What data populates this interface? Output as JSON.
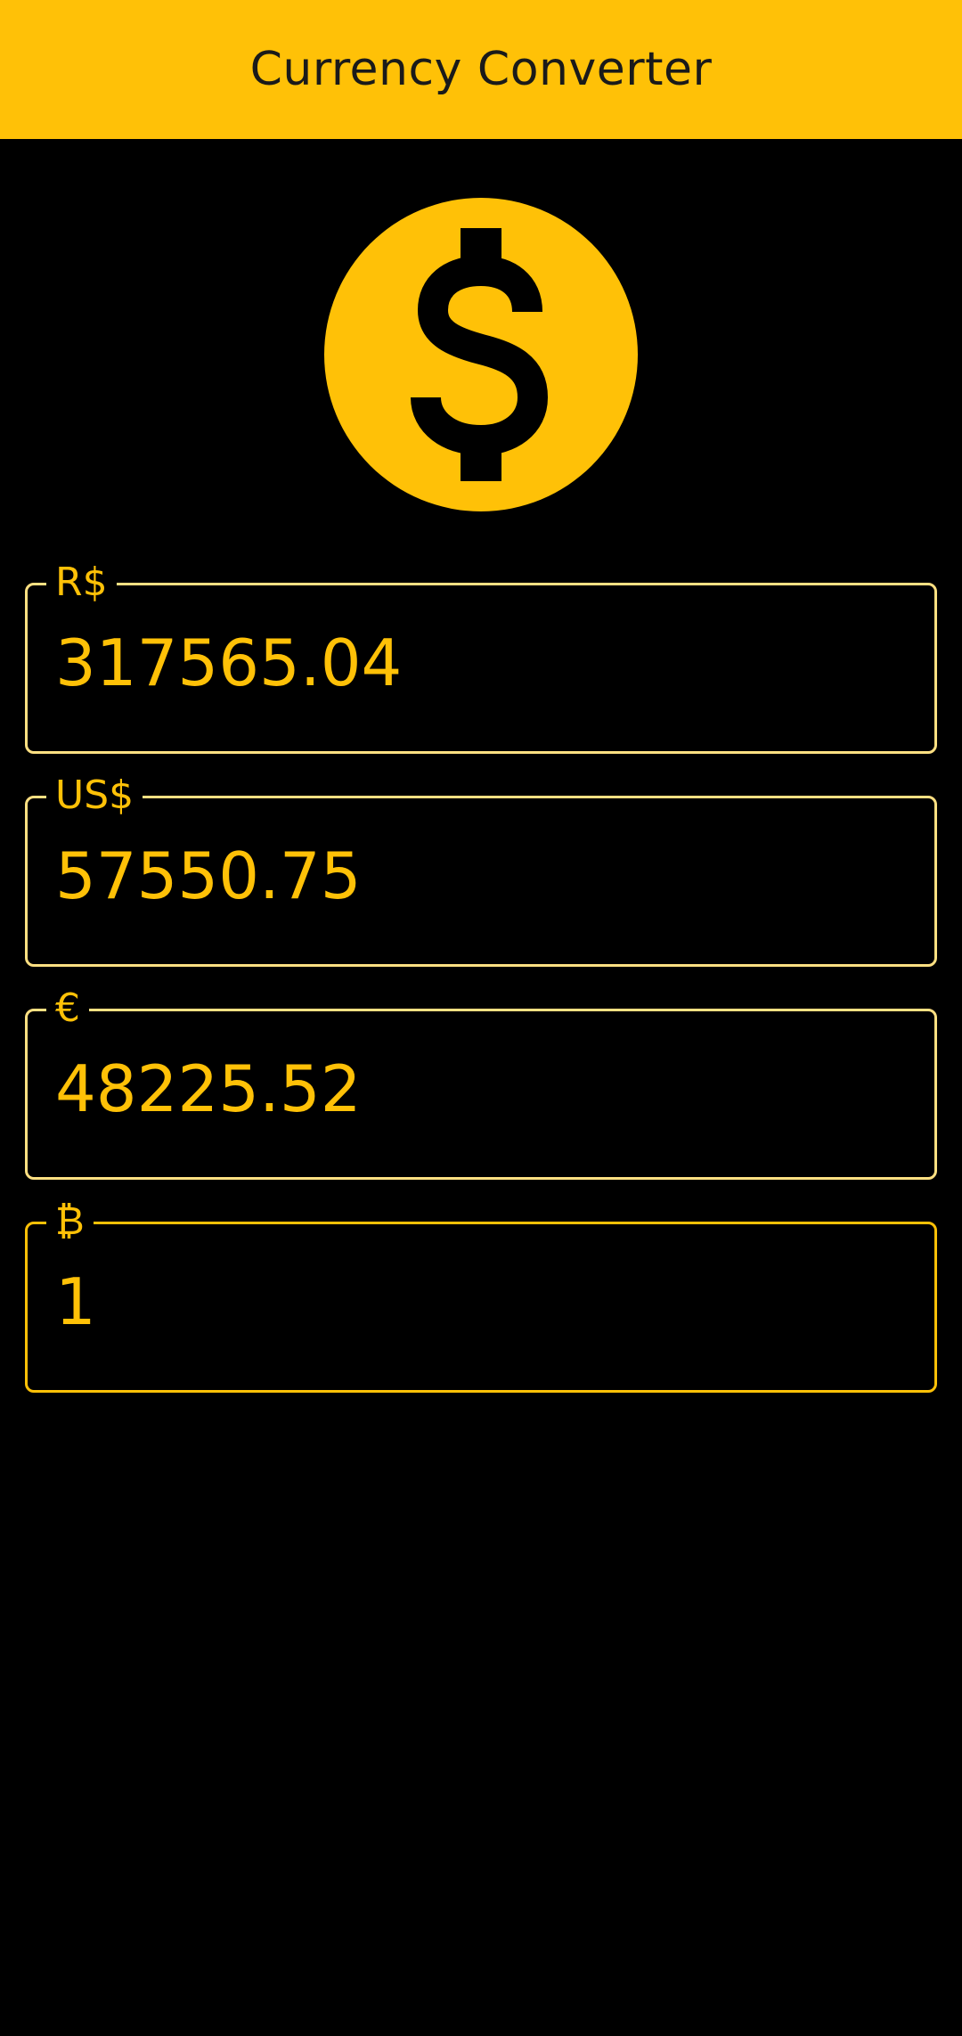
{
  "app_bar": {
    "title": "Currency Converter",
    "color": "#FFC107"
  },
  "logo": {
    "icon": "dollar-coin-icon",
    "color": "#FFC107"
  },
  "fields": {
    "brl": {
      "label": "R$",
      "value": "317565.04"
    },
    "usd": {
      "label": "US$",
      "value": "57550.75"
    },
    "eur": {
      "label": "€",
      "value": "48225.52"
    },
    "btc": {
      "label": "₿",
      "value": "1"
    }
  },
  "theme": {
    "background": "#000000",
    "accent": "#FFC107",
    "outline": "#FFE082"
  }
}
